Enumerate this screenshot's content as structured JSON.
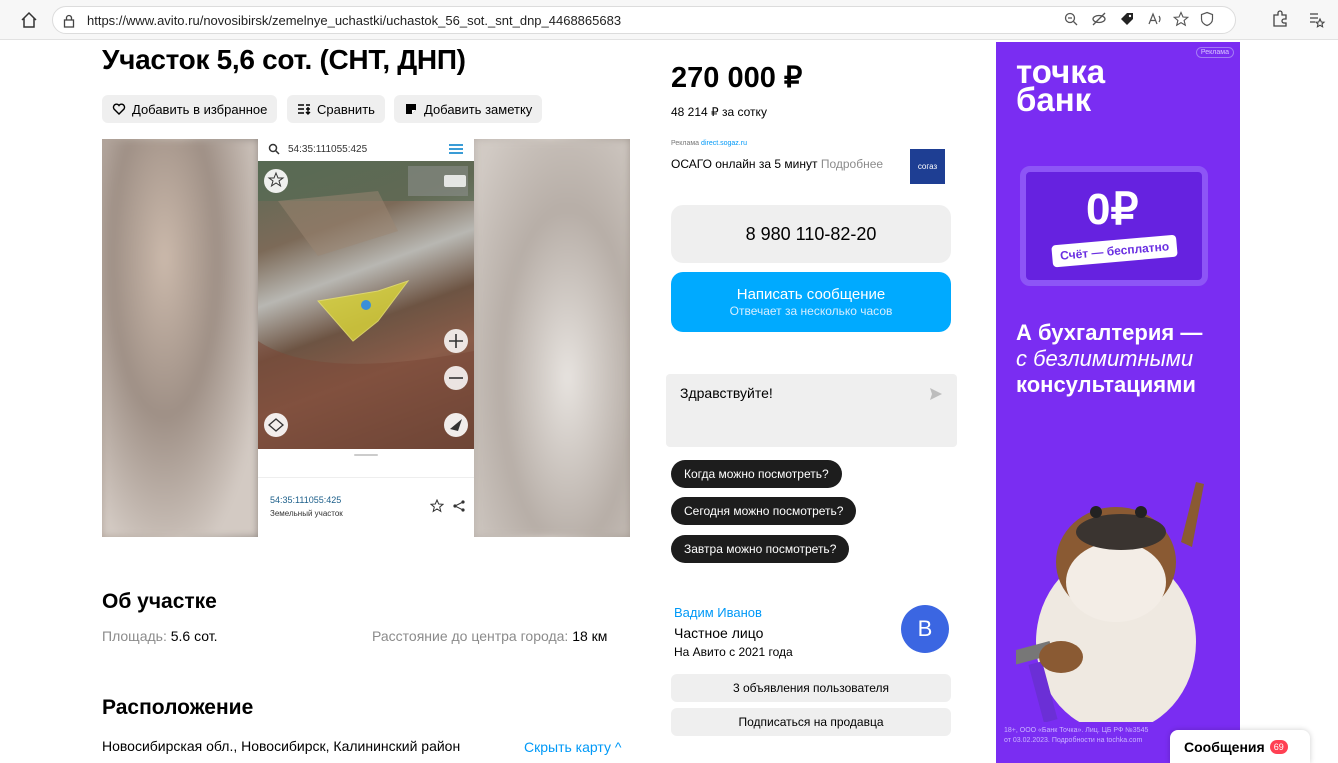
{
  "browser": {
    "url": "https://www.avito.ru/novosibirsk/zemelnye_uchastki/uchastok_56_sot._snt_dnp_4468865683"
  },
  "listing": {
    "title": "Участок 5,6 сот. (СНТ, ДНП)",
    "actions": {
      "favorite": "Добавить в избранное",
      "compare": "Сравнить",
      "note": "Добавить заметку"
    },
    "photo": {
      "search_text": "54:35:111055:425",
      "card_id": "54:35:111055:425",
      "card_type": "Земельный участок"
    },
    "about_heading": "Об участке",
    "area_label": "Площадь:",
    "area_value": "5.6 сот.",
    "distance_label": "Расстояние до центра города:",
    "distance_value": "18 км",
    "location_heading": "Расположение",
    "address": "Новосибирская обл., Новосибирск, Калининский район",
    "hide_map": "Скрыть карту ^"
  },
  "price": {
    "value": "270 000 ₽",
    "per_sotka": "48 214 ₽ за сотку"
  },
  "ad": {
    "label": "Реклама",
    "domain": "direct.sogaz.ru",
    "text": "ОСАГО онлайн за 5 минут",
    "more": "Подробнее",
    "logo": "согаз"
  },
  "contact": {
    "phone": "8 980 110-82-20",
    "message_label": "Написать сообщение",
    "message_sub": "Отвечает за несколько часов",
    "chat_text": "Здравствуйте!",
    "quick_replies": [
      "Когда можно посмотреть?",
      "Сегодня можно посмотреть?",
      "Завтра можно посмотреть?"
    ]
  },
  "seller": {
    "name": "Вадим Иванов",
    "type": "Частное лицо",
    "since": "На Авито с 2021 года",
    "avatar_letter": "В",
    "listings_btn": "3 объявления пользователя",
    "subscribe_btn": "Подписаться на продавца"
  },
  "banner": {
    "brand": "точка банк",
    "reklama": "Реклама",
    "zero": "0₽",
    "free": "Счёт — бесплатно",
    "slogan_1": "А бухгалтерия —",
    "slogan_2": "с безлимитными",
    "slogan_3": "консультациями",
    "legal_1": "18+, ООО «Банк Точка». Лиц. ЦБ РФ №3545",
    "legal_2": "от 03.02.2023. Подробности на tochka.com"
  },
  "messages": {
    "label": "Сообщения",
    "count": "69"
  },
  "colors": {
    "accent_blue": "#00aaff",
    "link_blue": "#0099f7",
    "banner_purple": "#7a2df2"
  }
}
